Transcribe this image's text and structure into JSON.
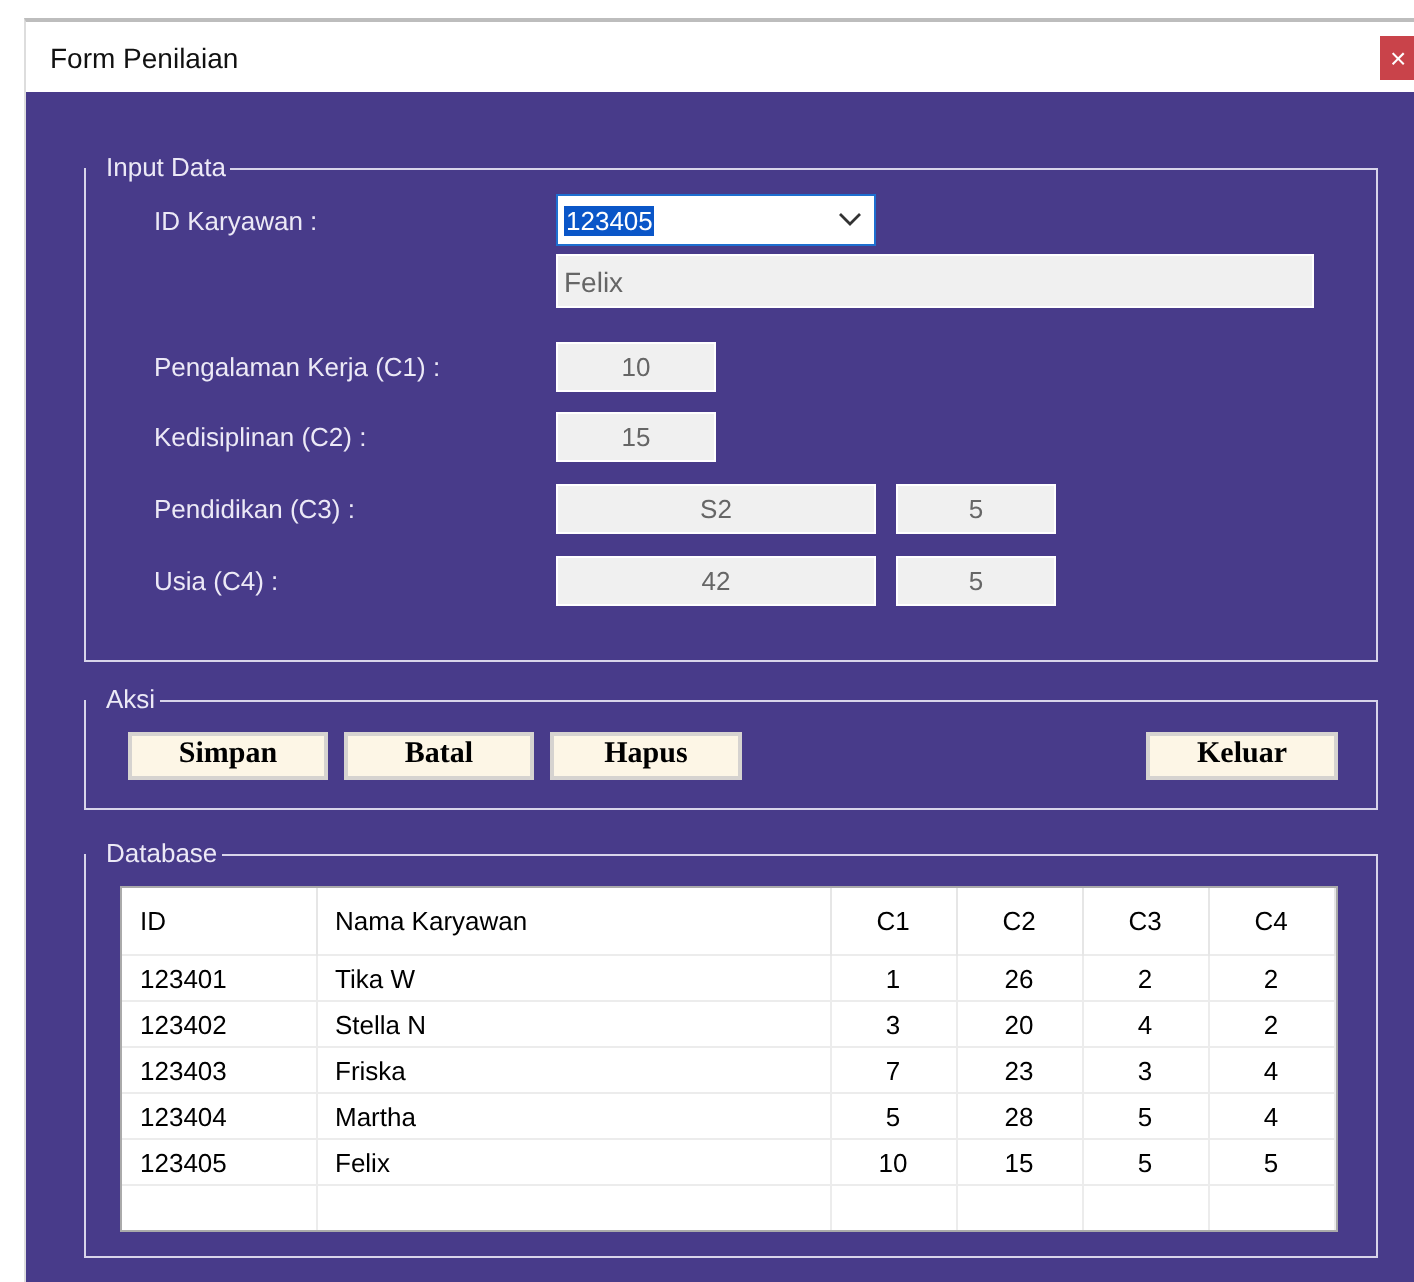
{
  "window": {
    "title": "Form Penilaian",
    "close": "×"
  },
  "input_data": {
    "legend": "Input Data",
    "id_label": "ID Karyawan :",
    "id_value": "123405",
    "id_value_selected": true,
    "name_value": "Felix",
    "criteria": [
      {
        "label": "Pengalaman Kerja (C1) :",
        "value": "10"
      },
      {
        "label": "Kedisiplinan (C2) :",
        "value": "15"
      },
      {
        "label": "Pendidikan (C3) :",
        "value": "S2",
        "score": "5"
      },
      {
        "label": "Usia (C4) :",
        "value": "42",
        "score": "5"
      }
    ]
  },
  "aksi": {
    "legend": "Aksi",
    "buttons": [
      {
        "label": "Simpan",
        "kind": "action"
      },
      {
        "label": "Batal",
        "kind": "action"
      },
      {
        "label": "Hapus",
        "kind": "action"
      },
      {
        "label": "Keluar",
        "kind": "exit"
      }
    ]
  },
  "database": {
    "legend": "Database",
    "columns": [
      "ID",
      "Nama Karyawan",
      "C1",
      "C2",
      "C3",
      "C4"
    ],
    "rows": [
      [
        "123401",
        "Tika W",
        "1",
        "26",
        "2",
        "2"
      ],
      [
        "123402",
        "Stella N",
        "3",
        "20",
        "4",
        "2"
      ],
      [
        "123403",
        "Friska",
        "7",
        "23",
        "3",
        "4"
      ],
      [
        "123404",
        "Martha",
        "5",
        "28",
        "5",
        "4"
      ],
      [
        "123405",
        "Felix",
        "10",
        "15",
        "5",
        "5"
      ]
    ]
  }
}
